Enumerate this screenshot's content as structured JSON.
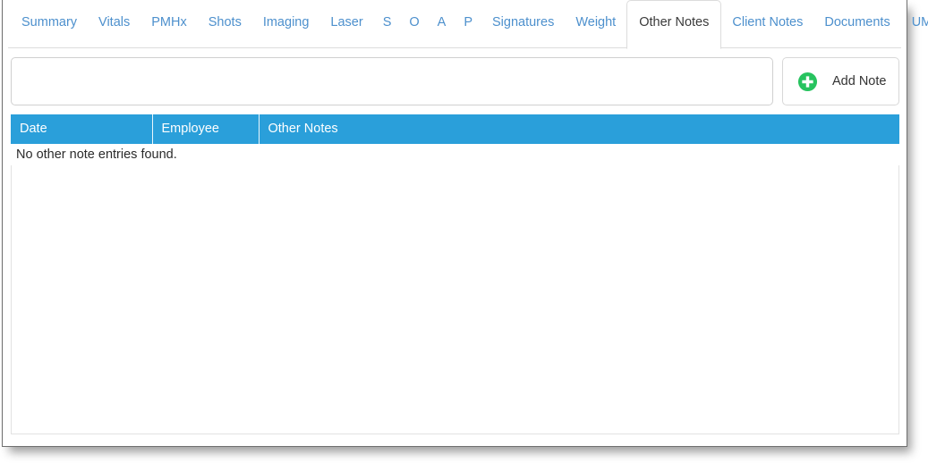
{
  "window": {
    "title": "Other Notes"
  },
  "tabs": [
    {
      "label": "Summary",
      "name": "tab-summary",
      "active": false,
      "letter": false
    },
    {
      "label": "Vitals",
      "name": "tab-vitals",
      "active": false,
      "letter": false
    },
    {
      "label": "PMHx",
      "name": "tab-pmhx",
      "active": false,
      "letter": false
    },
    {
      "label": "Shots",
      "name": "tab-shots",
      "active": false,
      "letter": false
    },
    {
      "label": "Imaging",
      "name": "tab-imaging",
      "active": false,
      "letter": false
    },
    {
      "label": "Laser",
      "name": "tab-laser",
      "active": false,
      "letter": false
    },
    {
      "label": "S",
      "name": "tab-s",
      "active": false,
      "letter": true
    },
    {
      "label": "O",
      "name": "tab-o",
      "active": false,
      "letter": true
    },
    {
      "label": "A",
      "name": "tab-a",
      "active": false,
      "letter": true
    },
    {
      "label": "P",
      "name": "tab-p",
      "active": false,
      "letter": true
    },
    {
      "label": "Signatures",
      "name": "tab-signatures",
      "active": false,
      "letter": false
    },
    {
      "label": "Weight",
      "name": "tab-weight",
      "active": false,
      "letter": false
    },
    {
      "label": "Other Notes",
      "name": "tab-other-notes",
      "active": true,
      "letter": false
    },
    {
      "label": "Client Notes",
      "name": "tab-client-notes",
      "active": false,
      "letter": false
    },
    {
      "label": "Documents",
      "name": "tab-documents",
      "active": false,
      "letter": false
    },
    {
      "label": "UMR Forms",
      "name": "tab-umr-forms",
      "active": false,
      "letter": false
    }
  ],
  "toolbar": {
    "note_input_value": "",
    "note_input_placeholder": "",
    "add_note_label": "Add Note",
    "add_note_icon": "plus-circle-icon"
  },
  "table": {
    "columns": [
      "Date",
      "Employee",
      "Other Notes"
    ],
    "rows": [],
    "empty_message": "No other note entries found."
  },
  "colors": {
    "header_blue": "#2a9fda",
    "tab_link_blue": "#4d90cd",
    "add_icon_green": "#27c35f",
    "active_tab_text": "#3a3a3a",
    "frame_border": "#6f6f6f"
  }
}
